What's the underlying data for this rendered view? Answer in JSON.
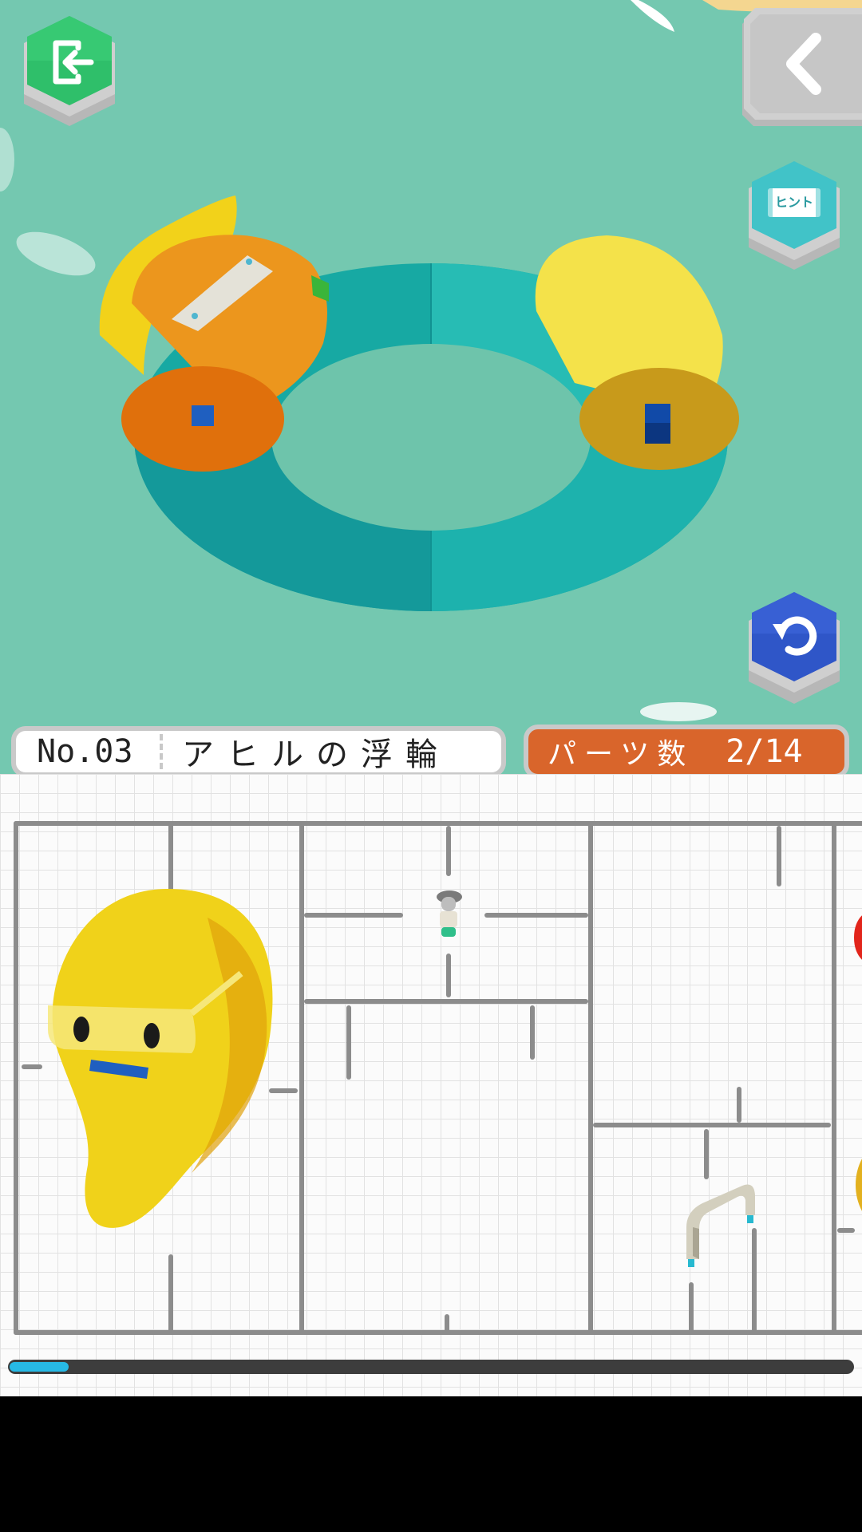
{
  "level": {
    "number": "No.03",
    "title": "アヒルの浮輪"
  },
  "parts": {
    "label": "パーツ数",
    "count": "2/14",
    "progress_fraction": 0.07
  },
  "buttons": {
    "exit": {
      "icon": "exit-icon",
      "color": "#2fbf6a"
    },
    "back": {
      "icon": "chevron-left-icon",
      "color": "#c9c9c9"
    },
    "hint": {
      "icon": "hint-icon",
      "label": "ヒント",
      "color": "#41c3c8"
    },
    "undo": {
      "icon": "undo-icon",
      "color": "#2f56c8"
    }
  },
  "colors": {
    "scene_bg": "#74c8b0",
    "ring": "#1fb3ad",
    "accent_orange": "#d9652b"
  }
}
